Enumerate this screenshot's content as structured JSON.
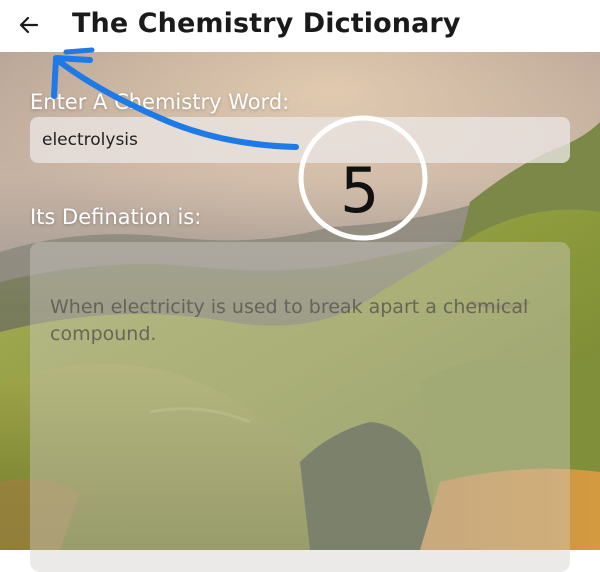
{
  "app_bar": {
    "title": "The Chemistry Dictionary",
    "back_icon": "arrow-left-icon"
  },
  "form": {
    "word_label": "Enter A Chemistry Word:",
    "word_value": "electrolysis",
    "definition_label": "Its Defination is:",
    "definition_text": "When electricity is used to break apart a chemical compound."
  },
  "annotation": {
    "number": "5",
    "arrow_color": "#1e7ae6",
    "circle_color": "#ffffff"
  }
}
